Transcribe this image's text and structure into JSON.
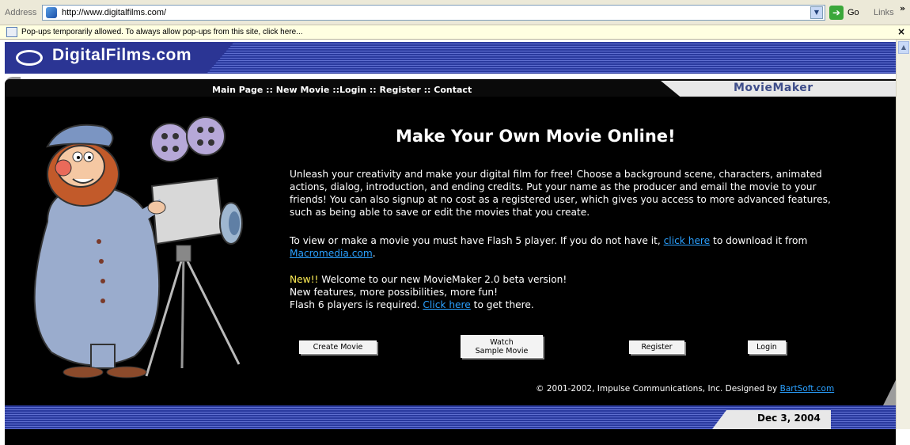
{
  "browser": {
    "address_label": "Address",
    "url": "http://www.digitalfilms.com/",
    "go_label": "Go",
    "links_label": "Links",
    "chevron": "»",
    "infobar_text": "Pop-ups temporarily allowed. To always allow pop-ups from this site, click here...",
    "infobar_close": "×"
  },
  "site": {
    "logo": "DigitalFilms.com",
    "product": "MovieMaker",
    "nav": [
      {
        "label": "Main Page"
      },
      {
        "label": "New Movie"
      },
      {
        "label": "Login"
      },
      {
        "label": "Register"
      },
      {
        "label": "Contact"
      }
    ],
    "nav_sep1": " :: ",
    "nav_sep2": " ::",
    "nav_sep3": " :: ",
    "nav_sep4": " :: "
  },
  "main": {
    "headline": "Make Your Own Movie Online!",
    "p1": "Unleash your creativity and make your digital film for free! Choose a background scene, characters, animated actions, dialog, introduction, and ending credits. Put your name as the producer and email the movie to your friends! You can also signup at no cost as a registered user, which gives you access to more advanced features, such as being able to save or edit the movies that you create.",
    "p2_a": "To view or make a movie you must have Flash 5 player. If you do not have it, ",
    "p2_link1": "click here",
    "p2_b": " to download it from ",
    "p2_link2": "Macromedia.com",
    "p2_c": ".",
    "p3_new": "New!!",
    "p3_a": " Welcome to our new MovieMaker 2.0 beta version!",
    "p3_b": "New features, more possibilities, more fun!",
    "p3_c": "Flash 6 players is required. ",
    "p3_link": "Click here",
    "p3_d": " to get there.",
    "buttons": {
      "create": "Create Movie",
      "watch_l1": "Watch",
      "watch_l2": "Sample Movie",
      "register": "Register",
      "login": "Login"
    },
    "copyright": "© 2001-2002, Impulse Communications, Inc. Designed by ",
    "copyright_link": "BartSoft.com"
  },
  "footer": {
    "date": "Dec 3, 2004"
  },
  "colors": {
    "header_blue": "#2a3a9e",
    "link": "#2aa0ff",
    "new_yellow": "#ffee55"
  }
}
